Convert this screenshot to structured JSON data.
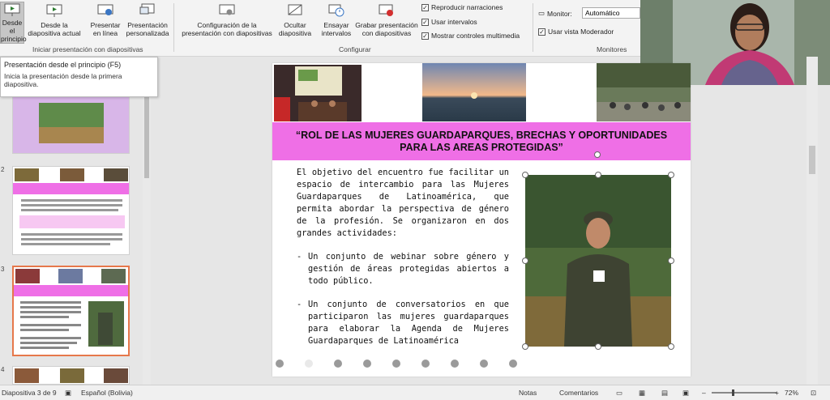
{
  "ribbon": {
    "buttons": [
      {
        "label": "Desde el principio"
      },
      {
        "label": "Desde la diapositiva actual"
      },
      {
        "label": "Presentar en línea"
      },
      {
        "label": "Presentación personalizada"
      },
      {
        "label": "Configuración de la presentación con diapositivas"
      },
      {
        "label": "Ocultar diapositiva"
      },
      {
        "label": "Ensayar intervalos"
      },
      {
        "label": "Grabar presentación con diapositivas"
      }
    ],
    "groups": {
      "start": "Iniciar presentación con diapositivas",
      "setup": "Configurar",
      "monitors": "Monitores"
    },
    "checkboxes": [
      {
        "label": "Reproducir narraciones",
        "checked": "✓"
      },
      {
        "label": "Usar intervalos",
        "checked": "✓"
      },
      {
        "label": "Mostrar controles multimedia",
        "checked": "✓"
      },
      {
        "label": "Usar vista Moderador",
        "checked": "✓"
      }
    ],
    "monitor_label": "Monitor:",
    "monitor_value": "Automático"
  },
  "tooltip": {
    "title": "Presentación desde el principio (F5)",
    "desc": "Inicia la presentación desde la primera diapositiva."
  },
  "thumbnails": {
    "n2": "2",
    "n3": "3",
    "n4": "4"
  },
  "slide": {
    "title": "“ROL DE LAS MUJERES GUARDAPARQUES, BRECHAS Y OPORTUNIDADES PARA LAS AREAS PROTEGIDAS”",
    "intro": "El objetivo del encuentro fue facilitar un espacio de intercambio para las Mujeres Guardaparques de Latinoamérica, que permita abordar la perspectiva de género de la profesión. Se organizaron en dos grandes actividades:",
    "bullets": [
      "Un conjunto de webinar sobre género y gestión de áreas protegidas abiertos a todo público.",
      "Un conjunto de conversatorios en que participaron las mujeres guardaparques para elaborar la Agenda de Mujeres Guardaparques de Latinoamérica"
    ]
  },
  "status": {
    "slide_info": "Diapositiva 3 de 9",
    "language": "Español (Bolivia)",
    "notes": "Notas",
    "comments": "Comentarios",
    "zoom": "72%"
  },
  "colors": {
    "banner": "#ef6fe6",
    "selection": "#e6784b"
  }
}
